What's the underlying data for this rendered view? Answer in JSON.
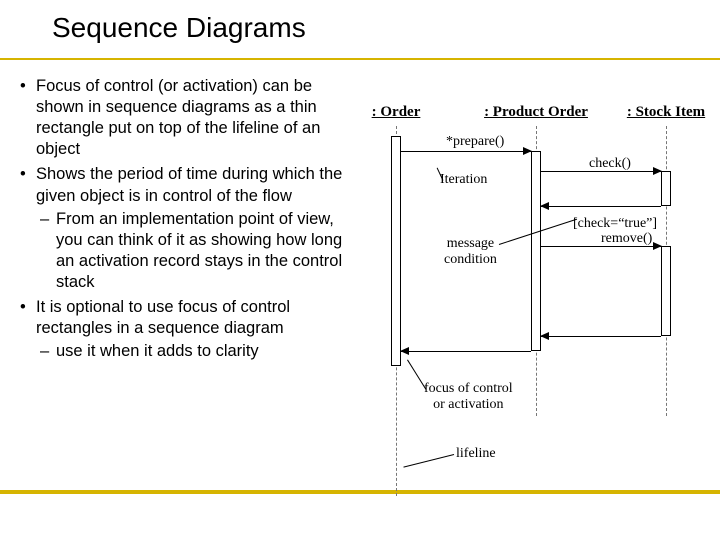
{
  "title": "Sequence Diagrams",
  "bullets": {
    "b1": "Focus of control (or activation) can be shown in sequence diagrams as a thin rectangle put on top of the lifeline of an object",
    "b2": "Shows the period of time during which the given object is in control of the flow",
    "b2s1": "From an implementation point of view, you can think of it as showing how long an activation record stays in the control stack",
    "b3": "It is optional to use focus of control rectangles in a sequence diagram",
    "b3s1": "use it when it adds to clarity"
  },
  "objects": {
    "order": ": Order",
    "productOrder": ": Product Order",
    "stockItem": ": Stock Item"
  },
  "messages": {
    "prepare": "*prepare()",
    "check": "check()",
    "checkCond": "[check=“true”]",
    "remove": "remove()"
  },
  "annotations": {
    "iteration": "Iteration",
    "messageCondition_l1": "message",
    "messageCondition_l2": "condition",
    "focus_l1": "focus of control",
    "focus_l2": "or activation",
    "lifeline": "lifeline"
  }
}
